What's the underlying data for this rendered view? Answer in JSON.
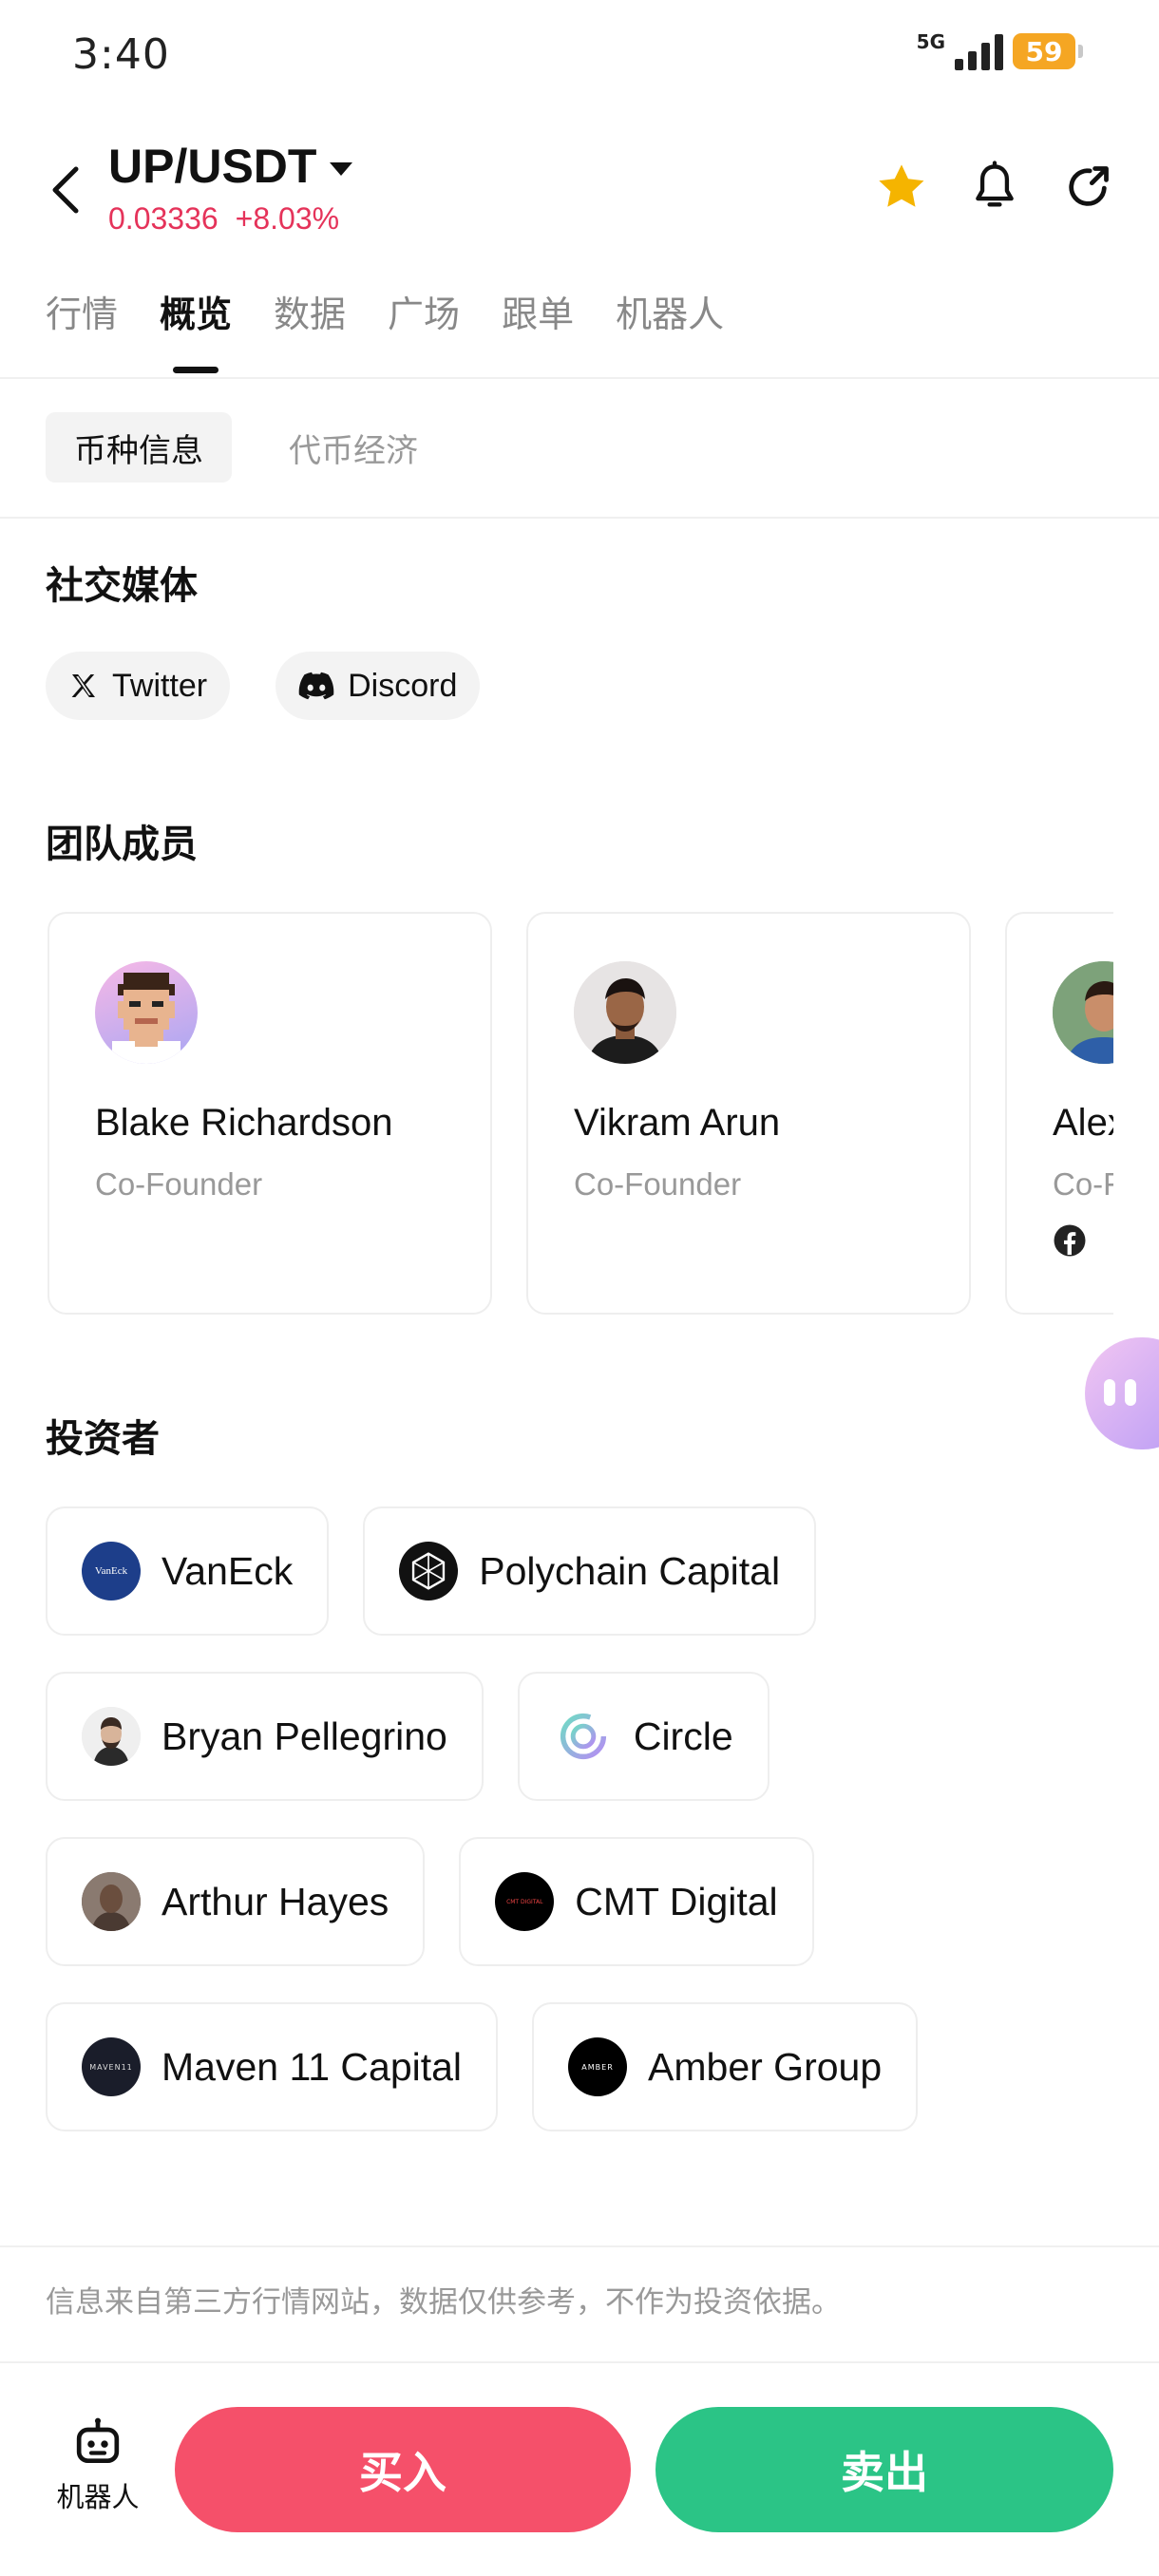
{
  "status_bar": {
    "time": "3:40",
    "network": "5G",
    "battery": "59"
  },
  "header": {
    "pair": "UP/USDT",
    "price": "0.03336",
    "change": "+8.03%"
  },
  "tabs": [
    {
      "label": "行情"
    },
    {
      "label": "概览"
    },
    {
      "label": "数据"
    },
    {
      "label": "广场"
    },
    {
      "label": "跟单"
    },
    {
      "label": "机器人"
    }
  ],
  "subtabs": [
    {
      "label": "币种信息"
    },
    {
      "label": "代币经济"
    }
  ],
  "social": {
    "title": "社交媒体",
    "items": [
      {
        "label": "Twitter",
        "icon": "x-logo-icon"
      },
      {
        "label": "Discord",
        "icon": "discord-icon"
      }
    ]
  },
  "team": {
    "title": "团队成员",
    "members": [
      {
        "name": "Blake Richardson",
        "role": "Co-Founder"
      },
      {
        "name": "Vikram Arun",
        "role": "Co-Founder"
      },
      {
        "name": "Alex",
        "role": "Co-Founder",
        "social": "facebook-icon"
      }
    ]
  },
  "investors": {
    "title": "投资者",
    "items": [
      {
        "name": "VanEck",
        "logo_text": "VanEck"
      },
      {
        "name": "Polychain Capital"
      },
      {
        "name": "Bryan Pellegrino"
      },
      {
        "name": "Circle"
      },
      {
        "name": "Arthur Hayes"
      },
      {
        "name": "CMT Digital",
        "logo_text": "CMT DIGITAL"
      },
      {
        "name": "Maven 11 Capital",
        "logo_text": "MAVEN11"
      },
      {
        "name": "Amber Group",
        "logo_text": "AMBER"
      }
    ]
  },
  "disclaimer": "信息来自第三方行情网站，数据仅供参考，不作为投资依据。",
  "bottom_bar": {
    "robot_label": "机器人",
    "buy_label": "买入",
    "sell_label": "卖出"
  },
  "colors": {
    "accent_red": "#e5335a",
    "buy": "#f5506a",
    "sell": "#2bc486",
    "star": "#f5b400",
    "battery": "#f5a623"
  }
}
